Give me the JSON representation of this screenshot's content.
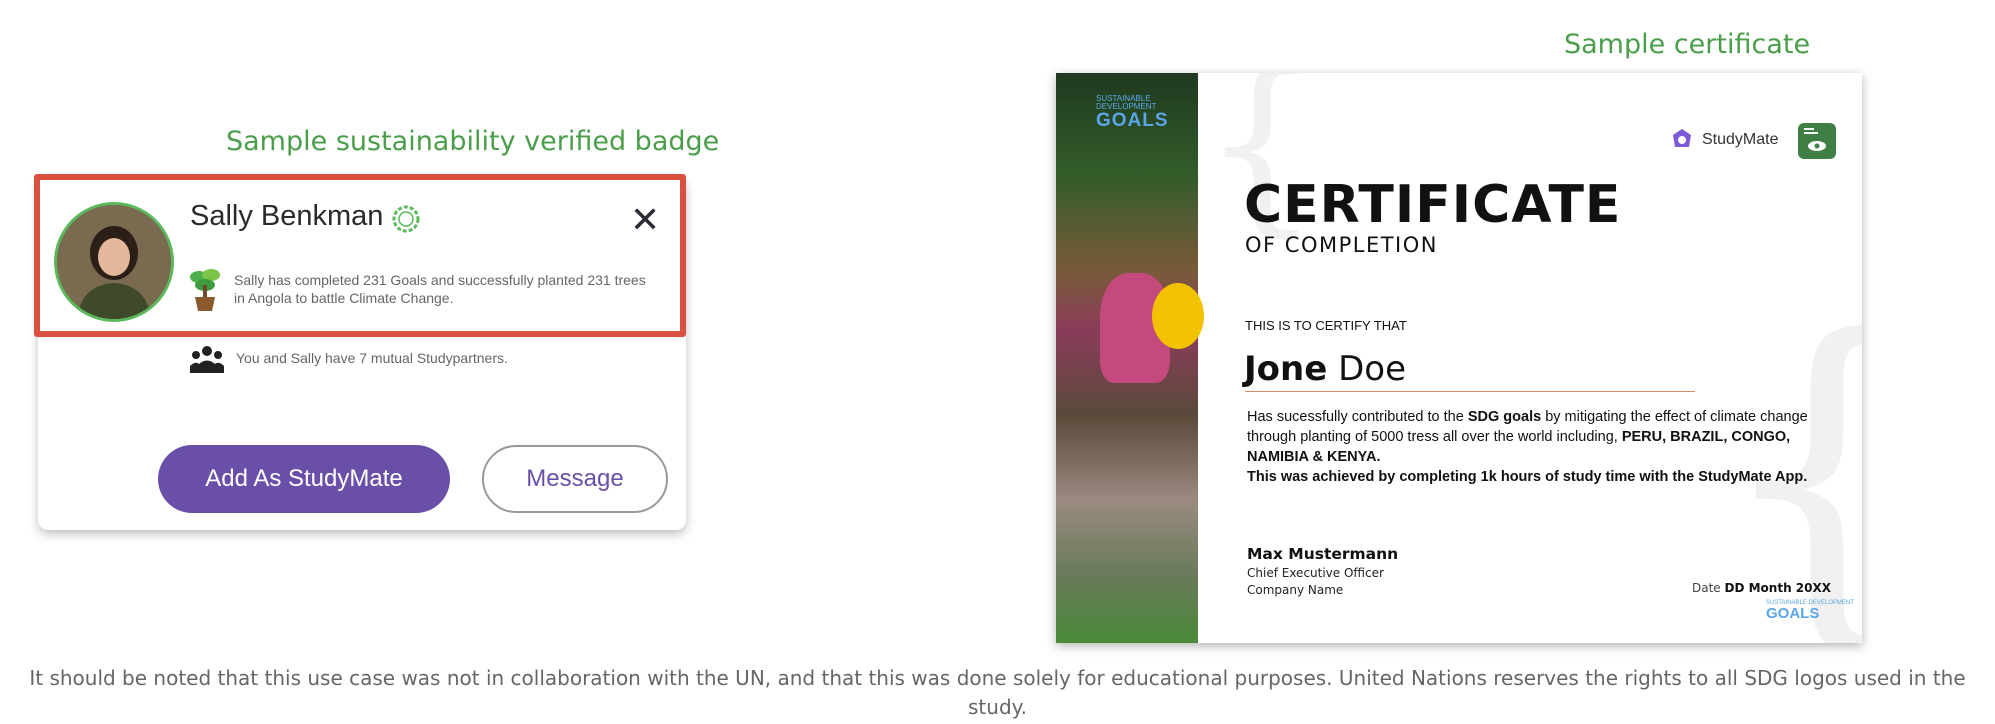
{
  "badge_section": {
    "caption": "Sample sustainability verified badge",
    "name": "Sally Benkman",
    "description": "Sally has completed 231 Goals and  successfully planted 231 trees in Angola to battle Climate Change.",
    "mutual": "You and Sally have 7 mutual Studypartners.",
    "add_button": "Add As StudyMate",
    "message_button": "Message",
    "close_glyph": "✕",
    "colors": {
      "accent": "#6a4fa8",
      "highlight": "#d9503f",
      "verified": "#5cb85c"
    }
  },
  "certificate_section": {
    "caption": "Sample certificate",
    "photo_logo_small": "SUSTAINABLE DEVELOPMENT",
    "photo_logo_goals": "GOALS",
    "brand": "StudyMate",
    "title": "CERTIFICATE",
    "subtitle": "OF COMPLETION",
    "certify_line": "THIS IS TO CERTIFY THAT",
    "recipient_first": "Jone",
    "recipient_last": "Doe",
    "body_1": "Has sucessfully contributed to the ",
    "body_bold_1": "SDG goals",
    "body_2": " by mitigating the effect of climate change through planting of 5000 tress all over the world including, ",
    "body_bold_2": "PERU, BRAZIL, CONGO, NAMIBIA & KENYA.",
    "body_bold_3": "This was achieved by completing 1k hours of study time with the StudyMate App.",
    "signer_name": "Max Mustermann",
    "signer_title": "Chief Executive Officer",
    "signer_company": "Company Name",
    "date_label": "Date",
    "date_value": "DD Month 20XX",
    "footer_logo_small": "SUSTAINABLE DEVELOPMENT",
    "footer_logo_goals": "GOALS"
  },
  "footnote": "It should be noted that this use case was not in collaboration with the UN, and that this was done solely for educational purposes.  United Nations reserves the rights to all SDG logos used in the study."
}
